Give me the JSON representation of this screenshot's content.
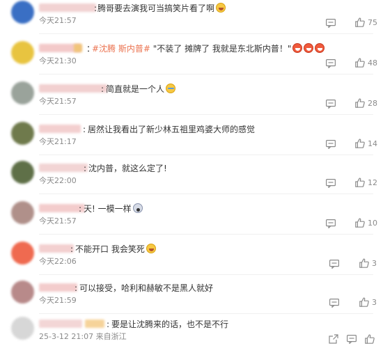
{
  "comments": [
    {
      "text_parts": [
        {
          "t": "腾哥要去演我可当搞笑片看了啊",
          "topic": false
        }
      ],
      "emojis": [
        "laugh"
      ],
      "time": "今天21:57",
      "likes": "75",
      "avatar_color": "#3a6fc4",
      "name_color": "#f2d2d2",
      "name_w": 82
    },
    {
      "text_parts": [
        {
          "t": "#沈腾 斯内普#",
          "topic": true
        },
        {
          "t": " \"不装了 摊牌了 我就是东北斯内普！\"",
          "topic": false
        }
      ],
      "emojis": [
        "cry",
        "cry",
        "cry"
      ],
      "time": "今天21:30",
      "likes": "48",
      "avatar_color": "#e8c440",
      "name_color": "#f3c9c9",
      "name_w": 60,
      "badge": true
    },
    {
      "text_parts": [
        {
          "t": "简直就是一个人",
          "topic": false
        }
      ],
      "emojis": [
        "grin"
      ],
      "time": "今天21:57",
      "likes": "28",
      "avatar_color": "#9aa39b",
      "name_color": "#f2d0d0",
      "name_w": 98
    },
    {
      "text_parts": [
        {
          "t": "居然让我看出了新少林五祖里鸡婆大师的感觉",
          "topic": false
        }
      ],
      "emojis": [],
      "time": "今天21:17",
      "likes": "14",
      "avatar_color": "#6f7a4c",
      "name_color": "#f3cfcf",
      "name_w": 60
    },
    {
      "text_parts": [
        {
          "t": "沈内普，就这么定了!",
          "topic": false
        }
      ],
      "emojis": [],
      "time": "今天22:00",
      "likes": "12",
      "avatar_color": "#5f7048",
      "name_color": "#f2d4d4",
      "name_w": 70
    },
    {
      "text_parts": [
        {
          "t": "天! 一模一样",
          "topic": false
        }
      ],
      "emojis": [
        "shock"
      ],
      "time": "今天21:57",
      "likes": "10",
      "avatar_color": "#b0908a",
      "name_color": "#f3cccc",
      "name_w": 66
    },
    {
      "text_parts": [
        {
          "t": "不能开口 我会笑死",
          "topic": false
        }
      ],
      "emojis": [
        "laugh"
      ],
      "time": "今天22:06",
      "likes": "3",
      "avatar_color": "#ef6a50",
      "name_color": "#f3d0d0",
      "name_w": 50
    },
    {
      "text_parts": [
        {
          "t": "可以接受，哈利和赫敏不是黑人就好",
          "topic": false
        }
      ],
      "emojis": [],
      "time": "今天21:59",
      "likes": "3",
      "avatar_color": "#b88a8a",
      "name_color": "#f3cccc",
      "name_w": 55
    },
    {
      "text_parts": [
        {
          "t": "要是让沈腾来的话，也不是不行",
          "topic": false
        }
      ],
      "emojis": [],
      "time": "25-3-12 21:07 来自浙江",
      "likes": "",
      "avatar_color": "#d7d7d7",
      "name_color": "#f3d6d6",
      "name_w": 62,
      "name2_color": "#f6d39a",
      "reply": true
    }
  ]
}
